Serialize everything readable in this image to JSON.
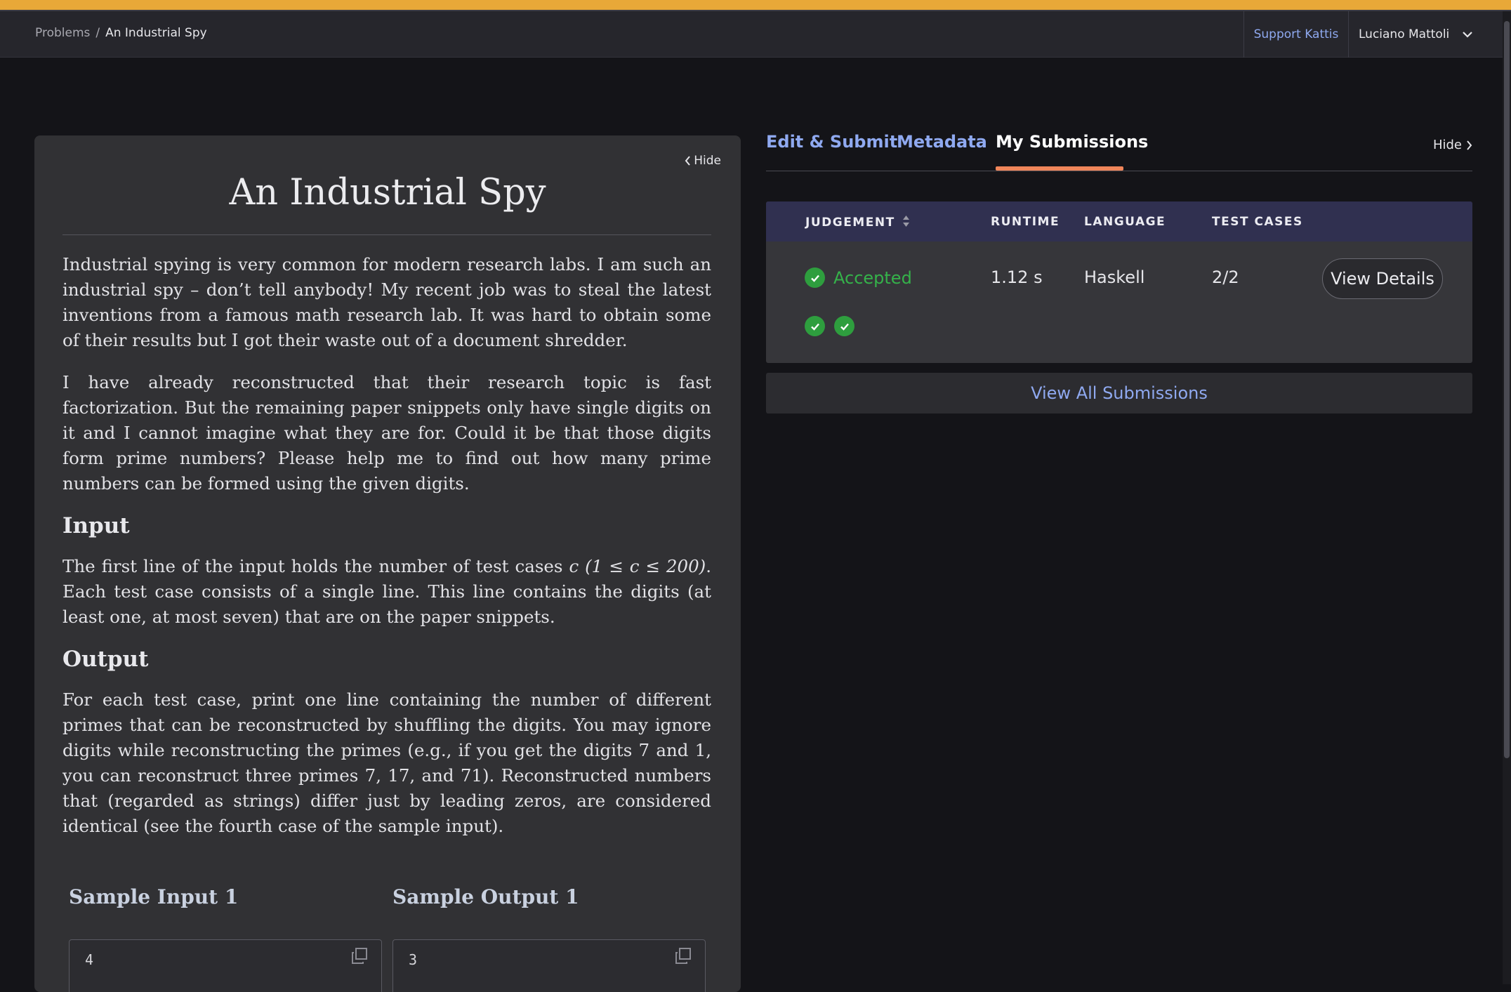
{
  "header": {
    "breadcrumb_root": "Problems",
    "breadcrumb_separator": "/",
    "breadcrumb_current": "An Industrial Spy",
    "support_link": "Support Kattis",
    "user_name": "Luciano Mattoli",
    "accent_color": "#e8a838"
  },
  "problem": {
    "hide_label": "Hide",
    "title": "An Industrial Spy",
    "intro_1": "Industrial spying is very common for modern research labs. I am such an industrial spy – don’t tell anybody! My recent job was to steal the latest inventions from a famous math research lab. It was hard to obtain some of their results but I got their waste out of a document shredder.",
    "intro_2": "I have already reconstructed that their research topic is fast factorization. But the remaining paper snippets only have single digits on it and I cannot imagine what they are for. Could it be that those digits form prime numbers? Please help me to find out how many prime numbers can be formed using the given digits.",
    "input_heading": "Input",
    "input_text_1": "The first line of the input holds the number of test cases ",
    "input_math": "c (1 ≤ c ≤ 200)",
    "input_text_2": ". Each test case consists of a single line. This line contains the digits (at least one, at most seven) that are on the paper snippets.",
    "output_heading": "Output",
    "output_text": "For each test case, print one line containing the number of different primes that can be reconstructed by shuffling the digits. You may ignore digits while reconstructing the primes (e.g., if you get the digits 7 and 1, you can reconstruct three primes 7, 17, and 71). Reconstructed numbers that (regarded as strings) differ just by leading zeros, are considered identical (see the fourth case of the sample input).",
    "sample_input_heading": "Sample Input 1",
    "sample_output_heading": "Sample Output 1",
    "sample_input_value": "4",
    "sample_output_value": "3"
  },
  "tabs": {
    "edit_submit": "Edit & Submit",
    "metadata": "Metadata",
    "my_submissions": "My Submissions",
    "active": "My Submissions",
    "hide_label": "Hide",
    "underline_color": "#f0865a"
  },
  "submissions": {
    "columns": {
      "judgement": "JUDGEMENT",
      "runtime": "RUNTIME",
      "language": "LANGUAGE",
      "test_cases": "TEST CASES"
    },
    "rows": [
      {
        "judgement": "Accepted",
        "runtime": "1.12 s",
        "language": "Haskell",
        "test_cases": "2/2",
        "details_label": "View Details",
        "status_color": "#35b24a"
      }
    ],
    "view_all_label": "View All Submissions"
  },
  "icons": {
    "breadcrumb": "none",
    "user_menu": "chevron-down-icon",
    "hide_left": "chevron-left-icon",
    "hide_right": "chevron-right-icon",
    "sort": "sort-icon",
    "status": "check-circle-icon",
    "copy": "copy-icon"
  }
}
